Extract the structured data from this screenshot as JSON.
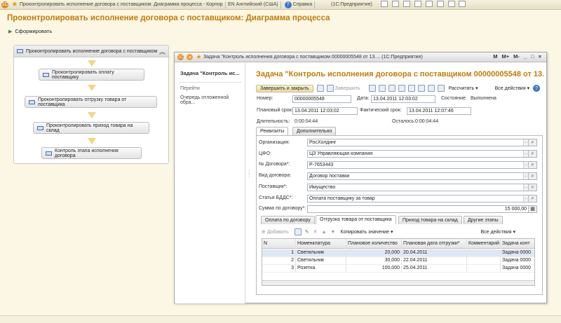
{
  "topbar": {
    "tabs": [
      "Проконтролировать исполнение договора с поставщиком: Диаграмма процесса - Корпоративный м"
    ],
    "language": "EN Английский (США)",
    "help": "Справка",
    "app": "(1С:Предприятие)"
  },
  "page": {
    "title": "Проконтролировать исполнение договора с поставщиком: Диаграмма процесса",
    "form_button": "Сформировать"
  },
  "diagram": {
    "header": "Проконтролировать исполнение договора с поставщиком",
    "nodes": [
      "Проконтролировать оплату поставщику",
      "Проконтролировать отгрузку товара от поставщика",
      "Проконтролировать приход товара на склад",
      "Контроль этапа исполнения договора"
    ]
  },
  "task": {
    "window_title": "Задача \"Контроль исполнения договора с поставщиком   00000005548 от 13....  (1С:Предприятие)",
    "window_buttons": [
      "M",
      "M+",
      "M-",
      "_",
      "□",
      "×"
    ],
    "left_title": "Задача \"Контроль ис...",
    "left_nav_header": "Перейти",
    "left_nav_item": "Очередь отложенной обра...",
    "title": "Задача \"Контроль исполнения договора с поставщиком  00000005548 от 13....",
    "toolbar": {
      "save_close": "Завершить и закрыть",
      "finish": "Завершить",
      "calc": "Рассчитать",
      "all_actions": "Все действия",
      "help": "?"
    },
    "fields": {
      "number_label": "Номер:",
      "number": "00000005548",
      "date_label": "Дата:",
      "date": "13.04.2011 12:03:02",
      "state_label": "Состояние:",
      "state": "Выполнена",
      "plan_label": "Плановый срок:",
      "plan": "13.04.2011 12:03:02",
      "fact_label": "Фактический срок:",
      "fact": "13.04.2011 12:07:46",
      "duration_label": "Длительность:",
      "duration": "0:00:04:44",
      "remaining_label": "Осталось:",
      "remaining": "0:00:04:44"
    },
    "tabs": [
      "Реквизиты",
      "Дополнительно"
    ],
    "requisites": [
      {
        "label": "Организация:",
        "value": "РосХолдинг"
      },
      {
        "label": "ЦФО:",
        "value": "ЦЗ Управляющая компания"
      },
      {
        "label": "№ Договора*:",
        "value": "Р-7653443"
      },
      {
        "label": "Вид договора:",
        "value": "Договор поставки"
      },
      {
        "label": "Поставщик*:",
        "value": "Имущество"
      },
      {
        "label": "Статья БДДС*:",
        "value": "Оплата поставщику за товар"
      },
      {
        "label": "Сумма по договору*:",
        "value": "15 000,00"
      }
    ],
    "sub_tabs": [
      "Оплата по договору",
      "Отгрузка товара от поставщика",
      "Приход товара на склад",
      "Другие этапы"
    ],
    "sub_toolbar": {
      "add": "Добавить",
      "copy_value": "Копировать значение",
      "all_actions": "Все действия"
    },
    "table": {
      "columns": [
        "N",
        "Номенклатура",
        "Плановое количество",
        "Плановая дата отгрузки*",
        "Комментарий",
        "Задача конт"
      ],
      "rows": [
        [
          "1",
          "Светильник",
          "20,000",
          "20.04.2011",
          "",
          "Задача 0000"
        ],
        [
          "2",
          "Светильник",
          "30,000",
          "22.04.2011",
          "",
          "Задача 0000"
        ],
        [
          "3",
          "Розетка",
          "100,000",
          "25.04.2011",
          "",
          "Задача 0000"
        ]
      ]
    }
  }
}
